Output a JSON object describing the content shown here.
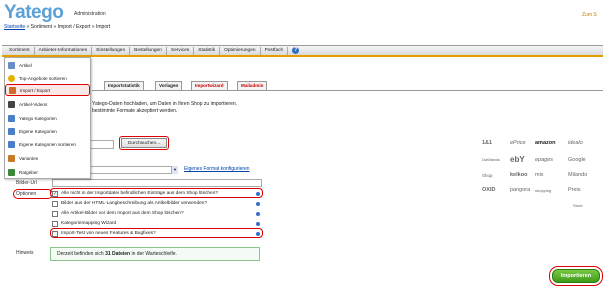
{
  "header": {
    "logo": "Yatego",
    "subtitle": "Administration",
    "right_link": "Zum S"
  },
  "breadcrumb": {
    "home": "Startseite",
    "rest": " » Sortiment » Import / Export » Import"
  },
  "menu": {
    "items": [
      "Sortiment",
      "Anbieter-Informationen",
      "Einstellungen",
      "Bestellungen",
      "Services",
      "Statistik",
      "Optimierungen",
      "Postfach"
    ],
    "help": "?"
  },
  "dropdown": {
    "items": [
      {
        "label": "Artikel",
        "icon": "article-icon",
        "color": "#6a8fc8"
      },
      {
        "label": "Top-Angebote sortieren",
        "icon": "star-icon",
        "color": "#e5b000"
      },
      {
        "label": "Import / Export",
        "icon": "import-export-icon",
        "color": "#d06a2a"
      },
      {
        "label": "Artikel-Videos",
        "icon": "video-icon",
        "color": "#444"
      },
      {
        "label": "Yatego Kategorien",
        "icon": "category-icon",
        "color": "#4a7fc8"
      },
      {
        "label": "Eigene Kategorien",
        "icon": "own-category-icon",
        "color": "#4a7fc8"
      },
      {
        "label": "Eigene Kategorien sortieren",
        "icon": "sort-icon",
        "color": "#4a7fc8"
      },
      {
        "label": "Varianten",
        "icon": "variants-icon",
        "color": "#c87a2a"
      },
      {
        "label": "Ratgeber",
        "icon": "guide-icon",
        "color": "#3a8a3a"
      }
    ],
    "selected_index": 2
  },
  "tabs": [
    {
      "label": "Importstatistik",
      "red": false
    },
    {
      "label": "Vorlagen",
      "red": false
    },
    {
      "label": "Importwizard",
      "red": true
    },
    {
      "label": "Mailadmin",
      "red": true
    }
  ],
  "intro": {
    "line1": "Yatego-Daten hochladen, um Daten in Ihren Shop zu importieren.",
    "line2": "bestimmte Formate akzeptiert werden."
  },
  "form": {
    "browse_label": "Durchsuchen...",
    "format_link": "Eigenes Format konfigurieren",
    "url_label": "Bilder-Url",
    "options_label": "Optionen",
    "options": [
      {
        "label": "Alle nicht in der Importdatei befindlichen Einträge aus dem Shop löschen?",
        "checked": true
      },
      {
        "label": "Bilder aus der HTML-Langbeschreibung als Artikelbilder verwenden?",
        "checked": false
      },
      {
        "label": "Alle Artikel-Bilder vor dem Import aus dem Shop löschen?",
        "checked": false
      },
      {
        "label": "Kategoriemapping Wizard",
        "checked": false
      },
      {
        "label": "Import-Test von neues Features & Bugfixes?",
        "checked": false
      }
    ],
    "hint_label": "Hinweis",
    "hint_prefix": "Derzeit befinden sich ",
    "hint_count": "31 Dateien",
    "hint_suffix": " in der Warteschleife.",
    "import_button": "Importieren"
  },
  "brands": [
    [
      "1&1",
      "ePrice",
      "amazon",
      "idealo"
    ],
    [
      "DaWanda",
      "ebY",
      "epages",
      "Google"
    ],
    [
      "Shop",
      "kelkoo",
      "mix",
      "Milando"
    ],
    [
      "OXID",
      "pangora",
      "shopping",
      "Preis"
    ],
    [
      "",
      "",
      "",
      "Store"
    ]
  ],
  "colors": {
    "accent": "#e5a000",
    "highlight": "#dd0000",
    "logo": "#5aa1d8",
    "link": "#0044aa",
    "button": "#4aa825"
  }
}
